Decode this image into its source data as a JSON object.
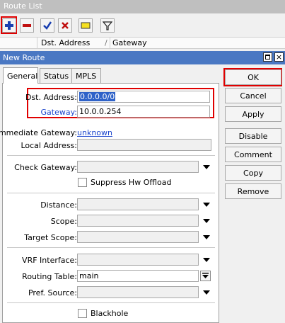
{
  "route_list": {
    "title": "Route List",
    "columns": [
      "Dst. Address",
      "Gateway"
    ],
    "toolbar": [
      "add-icon",
      "remove-icon",
      "enable-icon",
      "disable-icon",
      "comment-icon",
      "filter-icon"
    ]
  },
  "new_route": {
    "title": "New Route",
    "tabs": [
      "General",
      "Status",
      "MPLS"
    ],
    "fields": {
      "dst_address": {
        "label": "Dst. Address:",
        "value": "0.0.0.0/0"
      },
      "gateway": {
        "label": "Gateway:",
        "value": "10.0.0.254"
      },
      "immediate_gateway": {
        "label": "Immediate Gateway:",
        "value": "unknown"
      },
      "local_address": {
        "label": "Local Address:",
        "value": ""
      },
      "check_gateway": {
        "label": "Check Gateway:",
        "value": ""
      },
      "suppress_hw_offload": {
        "label": "Suppress Hw Offload"
      },
      "distance": {
        "label": "Distance:",
        "value": ""
      },
      "scope": {
        "label": "Scope:",
        "value": ""
      },
      "target_scope": {
        "label": "Target Scope:",
        "value": ""
      },
      "vrf_interface": {
        "label": "VRF Interface:",
        "value": ""
      },
      "routing_table": {
        "label": "Routing Table:",
        "value": "main"
      },
      "pref_source": {
        "label": "Pref. Source:",
        "value": ""
      },
      "blackhole": {
        "label": "Blackhole"
      }
    },
    "buttons": {
      "ok": "OK",
      "cancel": "Cancel",
      "apply": "Apply",
      "disable": "Disable",
      "comment": "Comment",
      "copy": "Copy",
      "remove": "Remove"
    }
  },
  "colors": {
    "highlight": "#e00000",
    "title_bar": "#4a78c3",
    "link": "#1a44cc"
  }
}
